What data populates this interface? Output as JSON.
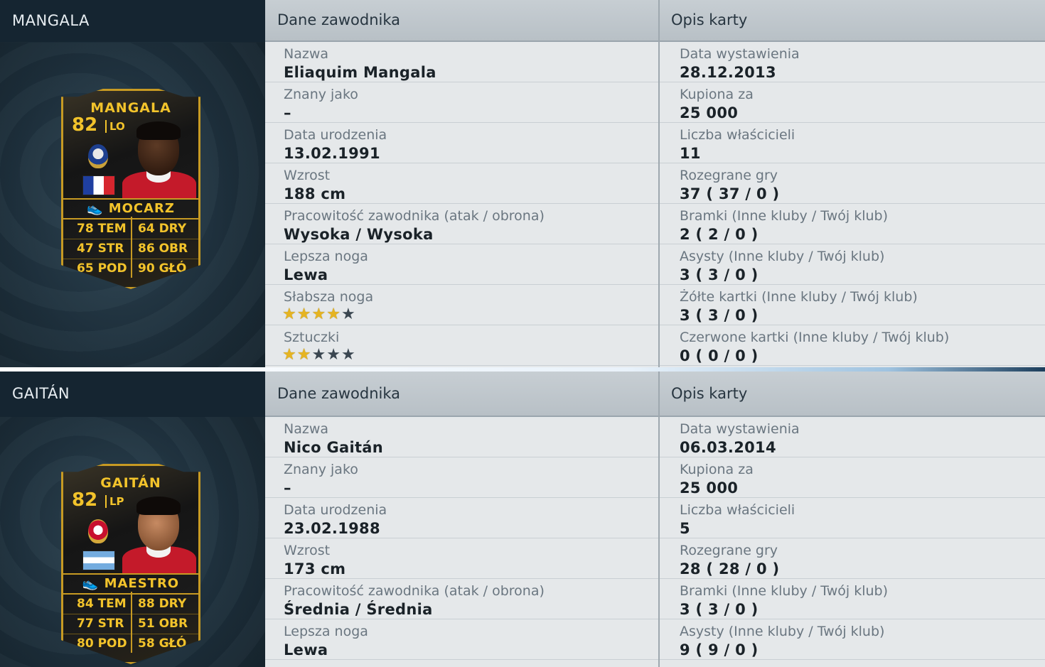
{
  "panels": [
    {
      "header": "MANGALA",
      "left_title": "Dane zawodnika",
      "right_title": "Opis karty",
      "card": {
        "name": "MANGALA",
        "rating": "82",
        "position": "LO",
        "club_badge": "fc-porto-badge-icon",
        "flag": "france-flag-icon",
        "chemistry_icon": "boot-icon",
        "chemistry": "MOCARZ",
        "stats": [
          {
            "l": "78 TEM",
            "r": "64 DRY"
          },
          {
            "l": "47 STR",
            "r": "86 OBR"
          },
          {
            "l": "65 POD",
            "r": "90 GŁÓ"
          }
        ]
      },
      "left_rows": [
        {
          "label": "Nazwa",
          "value": "Eliaquim Mangala"
        },
        {
          "label": "Znany jako",
          "value": "–"
        },
        {
          "label": "Data urodzenia",
          "value": "13.02.1991"
        },
        {
          "label": "Wzrost",
          "value": "188 cm"
        },
        {
          "label": "Pracowitość zawodnika (atak / obrona)",
          "value": "Wysoka / Wysoka"
        },
        {
          "label": "Lepsza noga",
          "value": "Lewa"
        },
        {
          "label": "Słabsza noga",
          "stars": 4
        },
        {
          "label": "Sztuczki",
          "stars": 2
        }
      ],
      "right_rows": [
        {
          "label": "Data wystawienia",
          "value": "28.12.2013"
        },
        {
          "label": "Kupiona za",
          "value": "25 000"
        },
        {
          "label": "Liczba właścicieli",
          "value": "11"
        },
        {
          "label": "Rozegrane gry",
          "value": "37 ( 37 / 0 )"
        },
        {
          "label": "Bramki (Inne kluby / Twój klub)",
          "value": "2 ( 2 / 0 )"
        },
        {
          "label": "Asysty (Inne kluby / Twój klub)",
          "value": "3 ( 3 / 0 )"
        },
        {
          "label": "Żółte kartki (Inne kluby / Twój klub)",
          "value": "3 ( 3 / 0 )"
        },
        {
          "label": "Czerwone kartki (Inne kluby / Twój klub)",
          "value": "0 ( 0 / 0 )"
        }
      ]
    },
    {
      "header": "GAITÁN",
      "left_title": "Dane zawodnika",
      "right_title": "Opis karty",
      "card": {
        "name": "GAITÁN",
        "rating": "82",
        "position": "LP",
        "club_badge": "benfica-badge-icon",
        "flag": "argentina-flag-icon",
        "chemistry_icon": "boot-icon",
        "chemistry": "MAESTRO",
        "stats": [
          {
            "l": "84 TEM",
            "r": "88 DRY"
          },
          {
            "l": "77 STR",
            "r": "51 OBR"
          },
          {
            "l": "80 POD",
            "r": "58 GŁÓ"
          }
        ]
      },
      "left_rows": [
        {
          "label": "Nazwa",
          "value": "Nico Gaitán"
        },
        {
          "label": "Znany jako",
          "value": "–"
        },
        {
          "label": "Data urodzenia",
          "value": "23.02.1988"
        },
        {
          "label": "Wzrost",
          "value": "173 cm"
        },
        {
          "label": "Pracowitość zawodnika (atak / obrona)",
          "value": "Średnia / Średnia"
        },
        {
          "label": "Lepsza noga",
          "value": "Lewa"
        }
      ],
      "right_rows": [
        {
          "label": "Data wystawienia",
          "value": "06.03.2014"
        },
        {
          "label": "Kupiona za",
          "value": "25 000"
        },
        {
          "label": "Liczba właścicieli",
          "value": "5"
        },
        {
          "label": "Rozegrane gry",
          "value": "28 ( 28 / 0 )"
        },
        {
          "label": "Bramki (Inne kluby / Twój klub)",
          "value": "3 ( 3 / 0 )"
        },
        {
          "label": "Asysty (Inne kluby / Twój klub)",
          "value": "9 ( 9 / 0 )"
        }
      ]
    }
  ],
  "colors": {
    "card_gold": "#f2c32b",
    "header_dark": "#152531",
    "star_on": "#e6b421",
    "star_off": "#3a4650"
  }
}
